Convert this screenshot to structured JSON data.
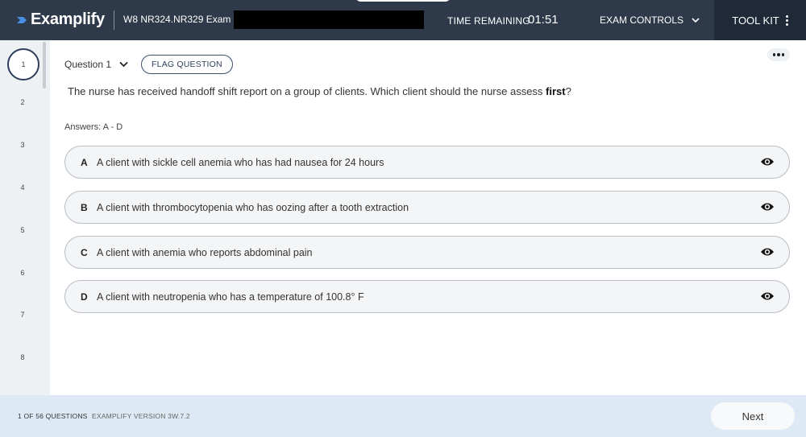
{
  "header": {
    "app_name": "Examplify",
    "exam_name": "W8 NR324.NR329 Exam 2",
    "timer_label": "TIME REMAINING",
    "timer_value": "01:51",
    "exam_controls_label": "EXAM CONTROLS",
    "toolkit_label": "TOOL KIT",
    "colors": {
      "header_bg": "#2e3a4a",
      "toolkit_bg": "#1f2937",
      "logo_accent": "#4a90e2"
    }
  },
  "sidebar": {
    "questions": [
      "1",
      "2",
      "3",
      "4",
      "5",
      "6",
      "7",
      "8"
    ],
    "active_index": 0
  },
  "question": {
    "label": "Question 1",
    "flag_label": "FLAG QUESTION",
    "stem_prefix": "The nurse has received handoff shift report on a group of clients. Which client should the nurse assess ",
    "stem_emphasis": "first",
    "stem_suffix": "?",
    "answers_label": "Answers: A - D",
    "options": [
      {
        "letter": "A",
        "text": "A client with sickle cell anemia who has had nausea for 24 hours"
      },
      {
        "letter": "B",
        "text": "A client with thrombocytopenia who has oozing after a tooth extraction"
      },
      {
        "letter": "C",
        "text": "A client with anemia who reports abdominal pain"
      },
      {
        "letter": "D",
        "text": "A client with neutropenia who has a temperature of 100.8° F"
      }
    ]
  },
  "footer": {
    "progress": "1 OF 56 QUESTIONS",
    "version": "EXAMPLIFY VERSION 3W.7.2",
    "next_label": "Next"
  }
}
